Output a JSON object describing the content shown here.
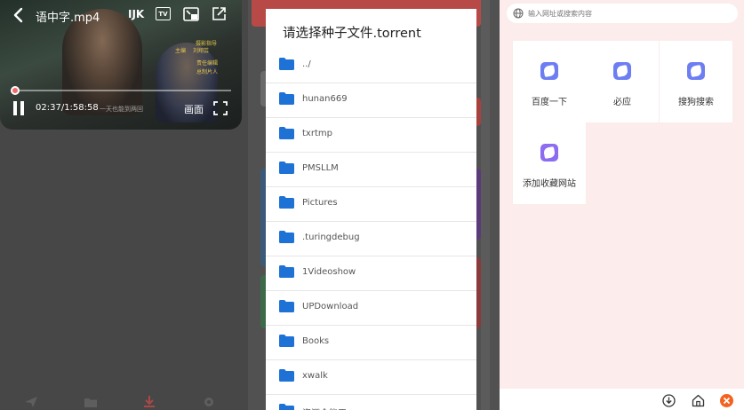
{
  "player": {
    "file_title": "语中字.mp4",
    "decoder_label": "IJK",
    "tv_label": "TV",
    "time": "02:37/1:58:58",
    "subtitle_text": "一天也能到两回",
    "aspect_label": "画面",
    "progress": 0.022,
    "credits": [
      "主编",
      "刘翔芸",
      "摄影指导",
      "责任编辑",
      "总制片人"
    ]
  },
  "chooser": {
    "title": "请选择种子文件.torrent",
    "items": [
      "../",
      "hunan669",
      "txrtmp",
      "PMSLLM",
      "Pictures",
      ".turingdebug",
      "1Videoshow",
      "UPDownload",
      "Books",
      "xwalk",
      "资源全能王"
    ]
  },
  "browser": {
    "search_placeholder": "输入网址或搜索内容",
    "sites": [
      {
        "label": "百度一下"
      },
      {
        "label": "必应"
      },
      {
        "label": "搜狗搜索"
      },
      {
        "label": "添加收藏网站"
      }
    ]
  },
  "colors": {
    "accent_red": "#f05a5a",
    "folder_blue": "#1e72d6",
    "site_blue": "#6c7ef2",
    "site_purple": "#8c6cf0",
    "close_orange": "#f4621f"
  }
}
